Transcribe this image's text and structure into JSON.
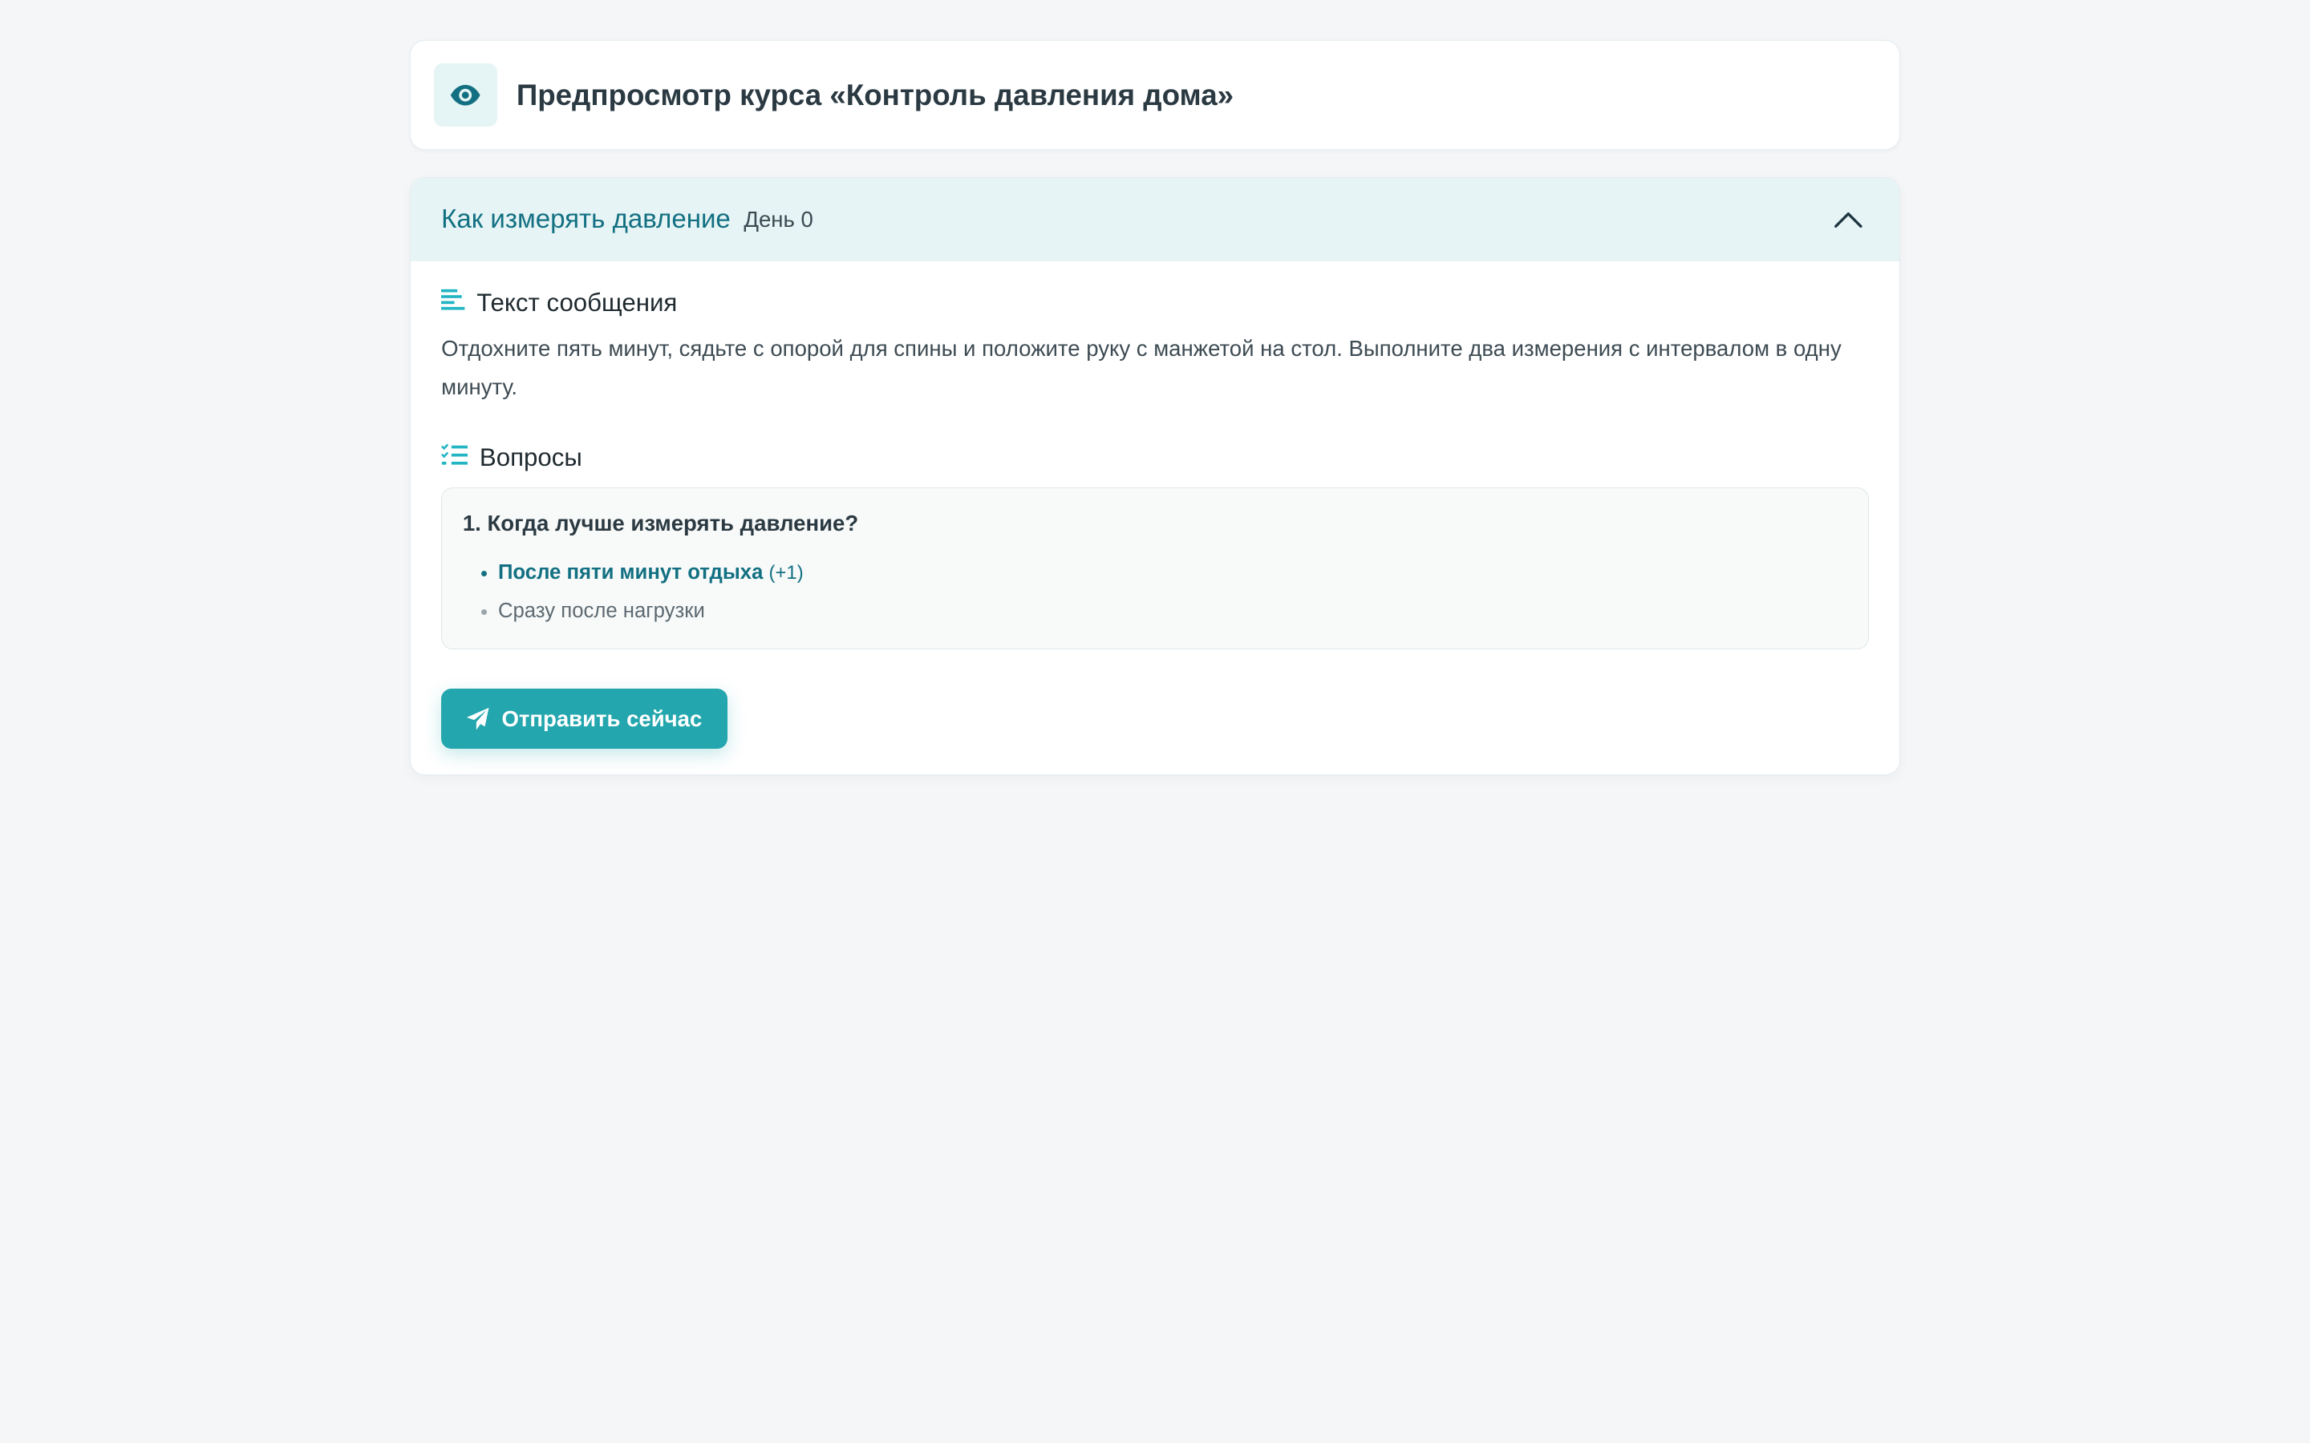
{
  "header": {
    "title": "Предпросмотр курса «Контроль давления дома»",
    "icon": "eye-icon"
  },
  "lesson": {
    "title": "Как измерять давление",
    "day": "День 0",
    "expanded": true,
    "message_section": {
      "label": "Текст сообщения",
      "icon": "text-lines-icon",
      "text": "Отдохните пять минут, сядьте с опорой для спины и положите руку с манжетой на стол. Выполните два измерения с интервалом в одну минуту."
    },
    "questions_section": {
      "label": "Вопросы",
      "icon": "checklist-icon",
      "items": [
        {
          "title": "1. Когда лучше измерять давление?",
          "answers": [
            {
              "text": "После пяти минут отдыха",
              "points": "(+1)",
              "correct": true
            },
            {
              "text": "Сразу после нагрузки",
              "points": "",
              "correct": false
            }
          ]
        }
      ]
    },
    "send_button": "Отправить сейчас"
  },
  "colors": {
    "accent": "#23a6ad",
    "accent_dark": "#127082",
    "header_bg": "#e6f4f5",
    "page_bg": "#f4f6f8"
  }
}
